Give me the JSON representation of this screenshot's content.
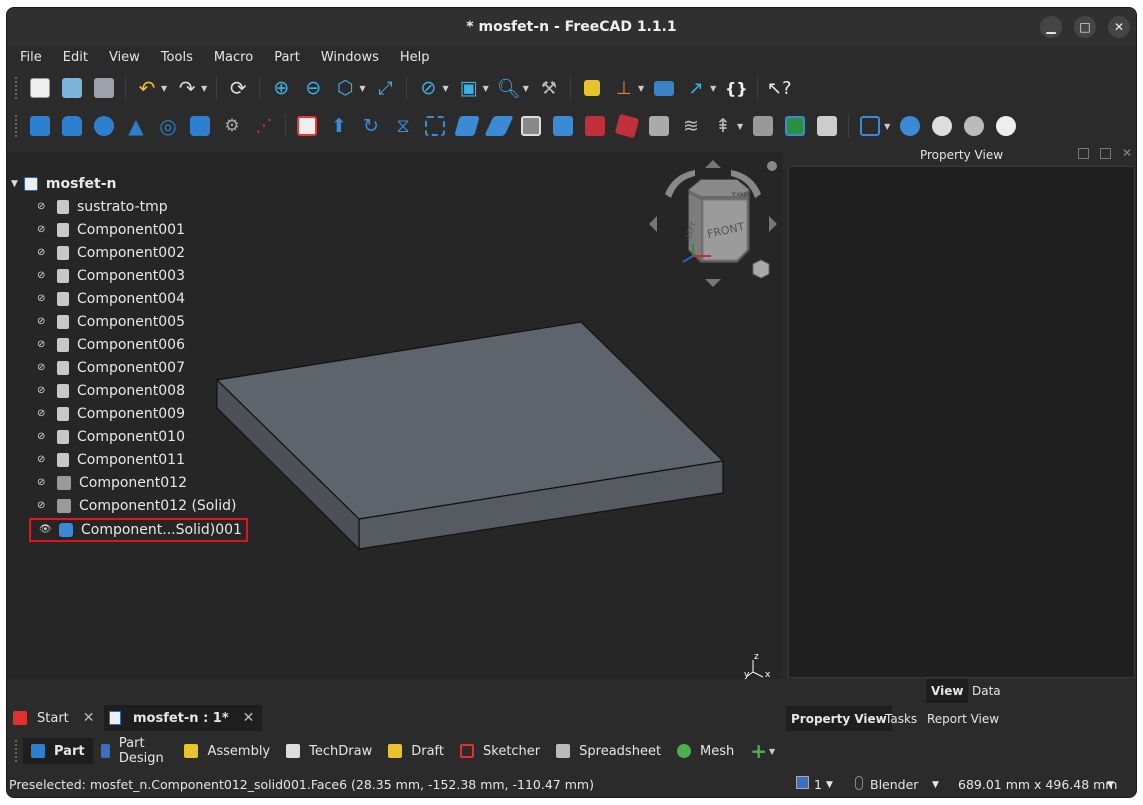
{
  "window": {
    "title": "* mosfet-n - FreeCAD 1.1.1"
  },
  "menubar": [
    "File",
    "Edit",
    "View",
    "Tools",
    "Macro",
    "Part",
    "Windows",
    "Help"
  ],
  "tree": {
    "root": "mosfet-n",
    "items": [
      {
        "label": "sustrato-tmp",
        "icon": "part-feature-icon"
      },
      {
        "label": "Component001",
        "icon": "part-feature-icon"
      },
      {
        "label": "Component002",
        "icon": "part-feature-icon"
      },
      {
        "label": "Component003",
        "icon": "part-feature-icon"
      },
      {
        "label": "Component004",
        "icon": "part-feature-icon"
      },
      {
        "label": "Component005",
        "icon": "part-feature-icon"
      },
      {
        "label": "Component006",
        "icon": "part-feature-icon"
      },
      {
        "label": "Component007",
        "icon": "part-feature-icon"
      },
      {
        "label": "Component008",
        "icon": "part-feature-icon"
      },
      {
        "label": "Component009",
        "icon": "part-feature-icon"
      },
      {
        "label": "Component010",
        "icon": "part-feature-icon"
      },
      {
        "label": "Component011",
        "icon": "part-feature-icon"
      },
      {
        "label": "Component012",
        "icon": "shape-icon"
      },
      {
        "label": "Component012 (Solid)",
        "icon": "shape-icon"
      },
      {
        "label": "Component...Solid)001",
        "icon": "compound-icon",
        "visible": true,
        "highlighted": true
      }
    ]
  },
  "navcube": {
    "top": "TOP",
    "front": "FRONT",
    "left": "LEFT"
  },
  "axis": {
    "z": "z",
    "x": "x",
    "y": "y"
  },
  "property_panel": {
    "title": "Property View",
    "subtabs": [
      "View",
      "Data"
    ],
    "bottom_tabs": [
      "Property View",
      "Tasks",
      "Report View"
    ]
  },
  "doc_tabs": [
    {
      "label": "Start"
    },
    {
      "label": "mosfet-n : 1*"
    }
  ],
  "workbenches": [
    "Part",
    "Part Design",
    "Assembly",
    "TechDraw",
    "Draft",
    "Sketcher",
    "Spreadsheet",
    "Mesh"
  ],
  "status": {
    "message": "Preselected: mosfet_n.Component012_solid001.Face6 (28.35 mm, -152.38 mm, -110.47 mm)",
    "views": "1",
    "nav_style": "Blender",
    "dimensions": "689.01 mm x 496.48 mm"
  },
  "colors": {
    "highlight": "#e0141a",
    "shape_top": "#5c626a",
    "shape_side": "#4a4f55",
    "bg": "#262626"
  }
}
